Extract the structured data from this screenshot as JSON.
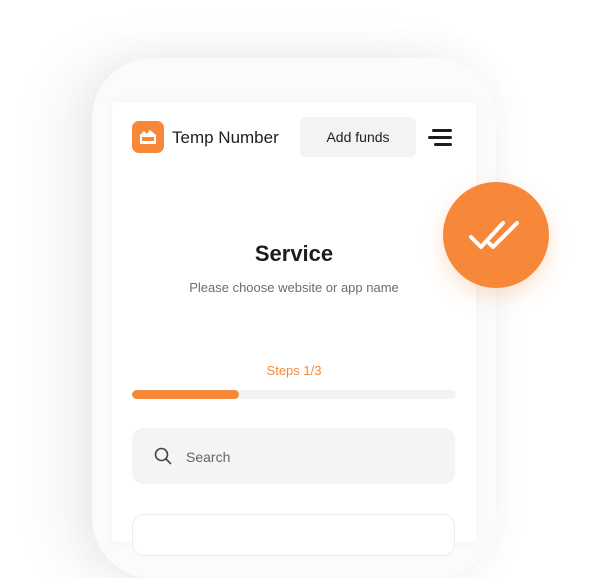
{
  "header": {
    "brand": "Temp Number",
    "add_funds_label": "Add funds",
    "logo_icon": "temp-number-logo",
    "menu_icon": "menu-icon"
  },
  "service": {
    "title": "Service",
    "subtitle": "Please choose website or app name"
  },
  "steps": {
    "label": "Steps 1/3",
    "progress": 0.33
  },
  "search": {
    "placeholder": "Search",
    "value": "",
    "icon": "search-icon"
  },
  "badge": {
    "icon": "double-check-icon"
  },
  "colors": {
    "accent": "#f7883a",
    "text": "#1d1d1d",
    "muted": "#6d6d6d"
  }
}
